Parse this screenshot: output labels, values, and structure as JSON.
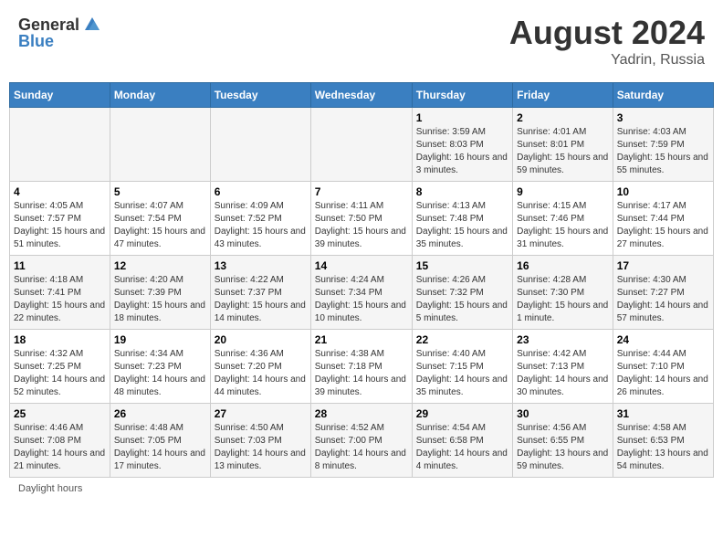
{
  "header": {
    "logo_general": "General",
    "logo_blue": "Blue",
    "main_title": "August 2024",
    "subtitle": "Yadrin, Russia"
  },
  "calendar": {
    "days_of_week": [
      "Sunday",
      "Monday",
      "Tuesday",
      "Wednesday",
      "Thursday",
      "Friday",
      "Saturday"
    ],
    "weeks": [
      [
        {
          "day": "",
          "info": ""
        },
        {
          "day": "",
          "info": ""
        },
        {
          "day": "",
          "info": ""
        },
        {
          "day": "",
          "info": ""
        },
        {
          "day": "1",
          "info": "Sunrise: 3:59 AM\nSunset: 8:03 PM\nDaylight: 16 hours and 3 minutes."
        },
        {
          "day": "2",
          "info": "Sunrise: 4:01 AM\nSunset: 8:01 PM\nDaylight: 15 hours and 59 minutes."
        },
        {
          "day": "3",
          "info": "Sunrise: 4:03 AM\nSunset: 7:59 PM\nDaylight: 15 hours and 55 minutes."
        }
      ],
      [
        {
          "day": "4",
          "info": "Sunrise: 4:05 AM\nSunset: 7:57 PM\nDaylight: 15 hours and 51 minutes."
        },
        {
          "day": "5",
          "info": "Sunrise: 4:07 AM\nSunset: 7:54 PM\nDaylight: 15 hours and 47 minutes."
        },
        {
          "day": "6",
          "info": "Sunrise: 4:09 AM\nSunset: 7:52 PM\nDaylight: 15 hours and 43 minutes."
        },
        {
          "day": "7",
          "info": "Sunrise: 4:11 AM\nSunset: 7:50 PM\nDaylight: 15 hours and 39 minutes."
        },
        {
          "day": "8",
          "info": "Sunrise: 4:13 AM\nSunset: 7:48 PM\nDaylight: 15 hours and 35 minutes."
        },
        {
          "day": "9",
          "info": "Sunrise: 4:15 AM\nSunset: 7:46 PM\nDaylight: 15 hours and 31 minutes."
        },
        {
          "day": "10",
          "info": "Sunrise: 4:17 AM\nSunset: 7:44 PM\nDaylight: 15 hours and 27 minutes."
        }
      ],
      [
        {
          "day": "11",
          "info": "Sunrise: 4:18 AM\nSunset: 7:41 PM\nDaylight: 15 hours and 22 minutes."
        },
        {
          "day": "12",
          "info": "Sunrise: 4:20 AM\nSunset: 7:39 PM\nDaylight: 15 hours and 18 minutes."
        },
        {
          "day": "13",
          "info": "Sunrise: 4:22 AM\nSunset: 7:37 PM\nDaylight: 15 hours and 14 minutes."
        },
        {
          "day": "14",
          "info": "Sunrise: 4:24 AM\nSunset: 7:34 PM\nDaylight: 15 hours and 10 minutes."
        },
        {
          "day": "15",
          "info": "Sunrise: 4:26 AM\nSunset: 7:32 PM\nDaylight: 15 hours and 5 minutes."
        },
        {
          "day": "16",
          "info": "Sunrise: 4:28 AM\nSunset: 7:30 PM\nDaylight: 15 hours and 1 minute."
        },
        {
          "day": "17",
          "info": "Sunrise: 4:30 AM\nSunset: 7:27 PM\nDaylight: 14 hours and 57 minutes."
        }
      ],
      [
        {
          "day": "18",
          "info": "Sunrise: 4:32 AM\nSunset: 7:25 PM\nDaylight: 14 hours and 52 minutes."
        },
        {
          "day": "19",
          "info": "Sunrise: 4:34 AM\nSunset: 7:23 PM\nDaylight: 14 hours and 48 minutes."
        },
        {
          "day": "20",
          "info": "Sunrise: 4:36 AM\nSunset: 7:20 PM\nDaylight: 14 hours and 44 minutes."
        },
        {
          "day": "21",
          "info": "Sunrise: 4:38 AM\nSunset: 7:18 PM\nDaylight: 14 hours and 39 minutes."
        },
        {
          "day": "22",
          "info": "Sunrise: 4:40 AM\nSunset: 7:15 PM\nDaylight: 14 hours and 35 minutes."
        },
        {
          "day": "23",
          "info": "Sunrise: 4:42 AM\nSunset: 7:13 PM\nDaylight: 14 hours and 30 minutes."
        },
        {
          "day": "24",
          "info": "Sunrise: 4:44 AM\nSunset: 7:10 PM\nDaylight: 14 hours and 26 minutes."
        }
      ],
      [
        {
          "day": "25",
          "info": "Sunrise: 4:46 AM\nSunset: 7:08 PM\nDaylight: 14 hours and 21 minutes."
        },
        {
          "day": "26",
          "info": "Sunrise: 4:48 AM\nSunset: 7:05 PM\nDaylight: 14 hours and 17 minutes."
        },
        {
          "day": "27",
          "info": "Sunrise: 4:50 AM\nSunset: 7:03 PM\nDaylight: 14 hours and 13 minutes."
        },
        {
          "day": "28",
          "info": "Sunrise: 4:52 AM\nSunset: 7:00 PM\nDaylight: 14 hours and 8 minutes."
        },
        {
          "day": "29",
          "info": "Sunrise: 4:54 AM\nSunset: 6:58 PM\nDaylight: 14 hours and 4 minutes."
        },
        {
          "day": "30",
          "info": "Sunrise: 4:56 AM\nSunset: 6:55 PM\nDaylight: 13 hours and 59 minutes."
        },
        {
          "day": "31",
          "info": "Sunrise: 4:58 AM\nSunset: 6:53 PM\nDaylight: 13 hours and 54 minutes."
        }
      ]
    ]
  },
  "footer": {
    "note": "Daylight hours"
  }
}
